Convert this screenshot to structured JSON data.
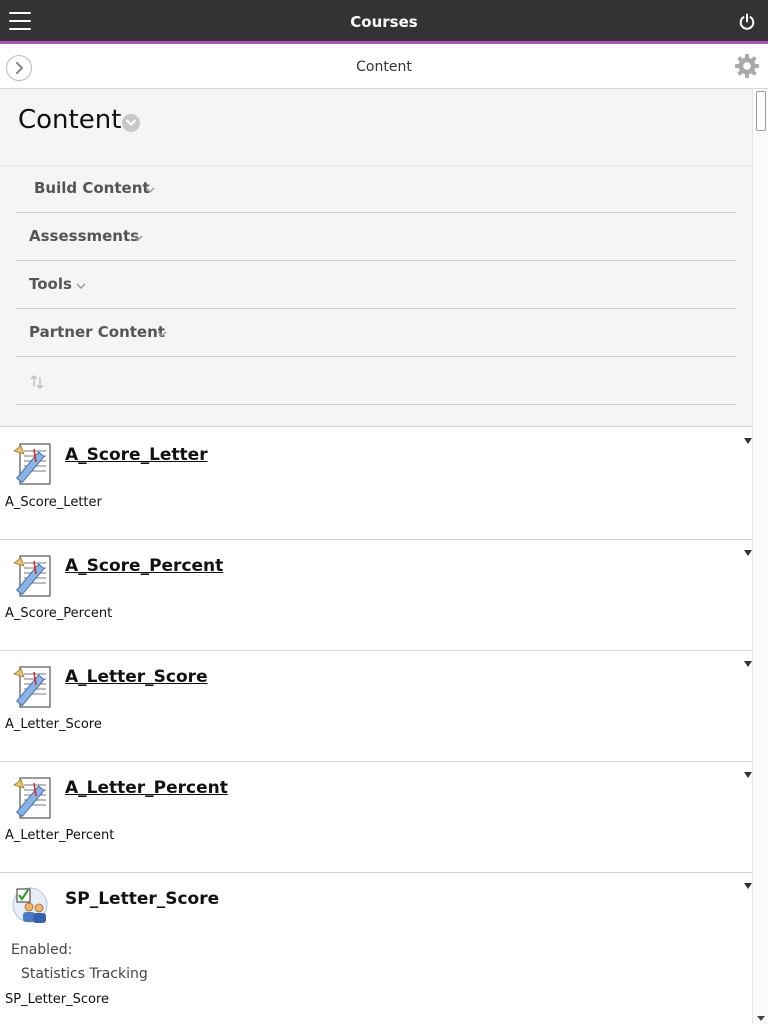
{
  "header": {
    "title": "Courses",
    "menu_icon": "hamburger-icon",
    "power_icon": "power-icon",
    "accent_color": "#b24fbb"
  },
  "subheader": {
    "title": "Content",
    "expand_icon": "chevron-right-icon",
    "settings_icon": "gear-icon"
  },
  "panel": {
    "page_title": "Content",
    "actions": [
      {
        "label": "Build Content"
      },
      {
        "label": "Assessments"
      },
      {
        "label": "Tools"
      },
      {
        "label": "Partner Content"
      }
    ],
    "sort_icon": "reorder-icon"
  },
  "items": [
    {
      "title": "A_Score_Letter",
      "description": "A_Score_Letter",
      "icon": "test-icon"
    },
    {
      "title": "A_Score_Percent",
      "description": "A_Score_Percent",
      "icon": "test-icon"
    },
    {
      "title": "A_Letter_Score",
      "description": "A_Letter_Score",
      "icon": "test-icon"
    },
    {
      "title": "A_Letter_Percent",
      "description": "A_Letter_Percent",
      "icon": "test-icon"
    },
    {
      "title": "SP_Letter_Score",
      "meta_label": "Enabled:",
      "meta_value": "Statistics Tracking",
      "description": "SP_Letter_Score",
      "icon": "survey-group-icon"
    }
  ]
}
